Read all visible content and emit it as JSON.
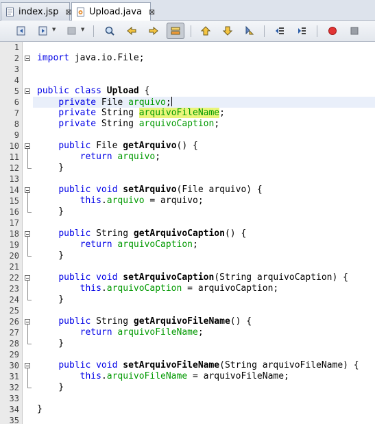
{
  "tabs": [
    {
      "label": "index.jsp",
      "close": "⊠",
      "active": false
    },
    {
      "label": "Upload.java",
      "close": "⊠",
      "active": true
    }
  ],
  "toolbar": {
    "icons": [
      "history-back-icon",
      "history-forward-icon",
      "last-edit-icon",
      "find-icon",
      "find-previous-icon",
      "find-next-icon",
      "toggle-highlight-icon",
      "previous-bookmark-icon",
      "next-bookmark-icon",
      "toggle-bookmark-icon",
      "shift-left-icon",
      "shift-right-icon",
      "record-macro-icon",
      "stop-macro-icon"
    ]
  },
  "colors": {
    "keyword": "#0000e6",
    "field": "#009900",
    "highlight": "#e9f57a"
  },
  "lines": [
    {
      "n": "1",
      "code": ""
    },
    {
      "n": "2",
      "code": "import java.io.File;"
    },
    {
      "n": "3",
      "code": ""
    },
    {
      "n": "4",
      "code": ""
    },
    {
      "n": "5",
      "code": "public class Upload {"
    },
    {
      "n": "6",
      "code": "    private File arquivo;"
    },
    {
      "n": "7",
      "code": "    private String arquivoFileName;"
    },
    {
      "n": "8",
      "code": "    private String arquivoCaption;"
    },
    {
      "n": "9",
      "code": ""
    },
    {
      "n": "10",
      "code": "    public File getArquivo() {"
    },
    {
      "n": "11",
      "code": "        return arquivo;"
    },
    {
      "n": "12",
      "code": "    }"
    },
    {
      "n": "13",
      "code": ""
    },
    {
      "n": "14",
      "code": "    public void setArquivo(File arquivo) {"
    },
    {
      "n": "15",
      "code": "        this.arquivo = arquivo;"
    },
    {
      "n": "16",
      "code": "    }"
    },
    {
      "n": "17",
      "code": ""
    },
    {
      "n": "18",
      "code": "    public String getArquivoCaption() {"
    },
    {
      "n": "19",
      "code": "        return arquivoCaption;"
    },
    {
      "n": "20",
      "code": "    }"
    },
    {
      "n": "21",
      "code": ""
    },
    {
      "n": "22",
      "code": "    public void setArquivoCaption(String arquivoCaption) {"
    },
    {
      "n": "23",
      "code": "        this.arquivoCaption = arquivoCaption;"
    },
    {
      "n": "24",
      "code": "    }"
    },
    {
      "n": "25",
      "code": ""
    },
    {
      "n": "26",
      "code": "    public String getArquivoFileName() {"
    },
    {
      "n": "27",
      "code": "        return arquivoFileName;"
    },
    {
      "n": "28",
      "code": "    }"
    },
    {
      "n": "29",
      "code": ""
    },
    {
      "n": "30",
      "code": "    public void setArquivoFileName(String arquivoFileName) {"
    },
    {
      "n": "31",
      "code": "        this.arquivoFileName = arquivoFileName;"
    },
    {
      "n": "32",
      "code": "    }"
    },
    {
      "n": "33",
      "code": ""
    },
    {
      "n": "34",
      "code": "}"
    },
    {
      "n": "35",
      "code": ""
    }
  ]
}
